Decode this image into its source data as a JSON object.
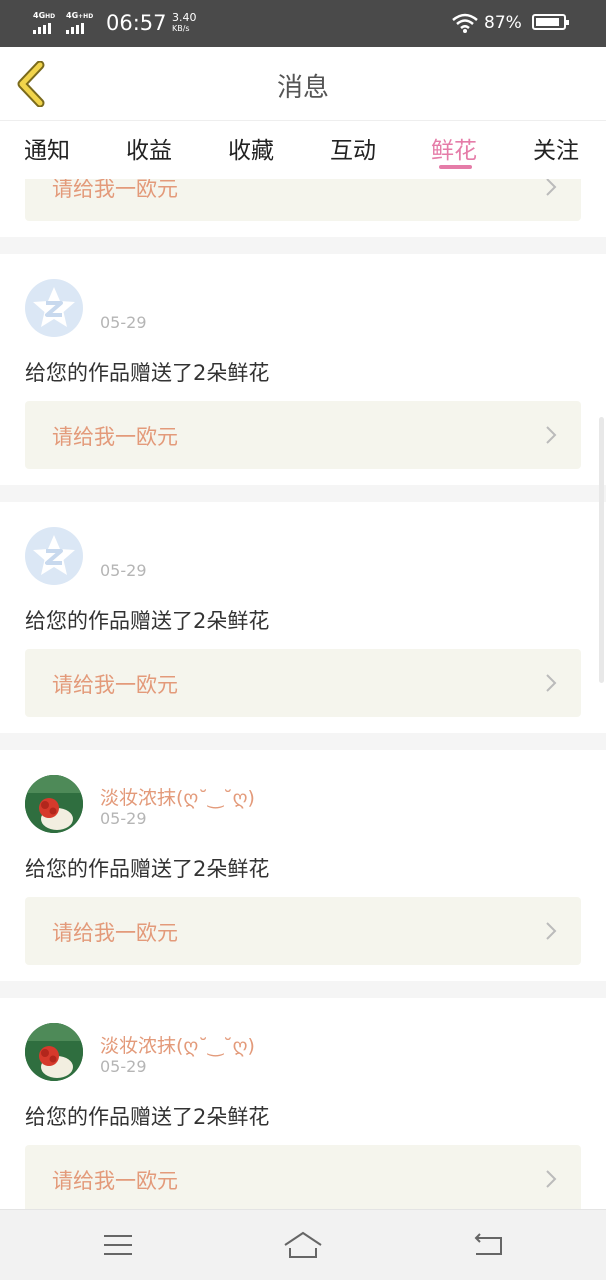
{
  "status_bar": {
    "network1": "4G",
    "network1_sup": "HD",
    "network2": "4G",
    "network2_sup": "+HD",
    "time": "06:57",
    "speed_value": "3.40",
    "speed_unit": "KB/s",
    "battery_percent": "87%",
    "battery_level": 0.87
  },
  "header": {
    "title": "消息",
    "back_icon": "chevron-left-icon"
  },
  "tabs": [
    {
      "label": "通知",
      "active": false
    },
    {
      "label": "收益",
      "active": false
    },
    {
      "label": "收藏",
      "active": false
    },
    {
      "label": "互动",
      "active": false
    },
    {
      "label": "鲜花",
      "active": true
    },
    {
      "label": "关注",
      "active": false
    }
  ],
  "colors": {
    "accent": "#e57ca8",
    "action_text": "#e39a7a",
    "action_bg": "#f5f5ed"
  },
  "messages": [
    {
      "username": "",
      "date": "",
      "text": "",
      "action_label": "请给我一欧元",
      "avatar": "partial"
    },
    {
      "username": "",
      "date": "05-29",
      "text": "给您的作品赠送了2朵鲜花",
      "action_label": "请给我一欧元",
      "avatar": "default-z-icon"
    },
    {
      "username": "",
      "date": "05-29",
      "text": "给您的作品赠送了2朵鲜花",
      "action_label": "请给我一欧元",
      "avatar": "default-z-icon"
    },
    {
      "username": "淡妆浓抹(ღ˘‿˘ღ)",
      "date": "05-29",
      "text": "给您的作品赠送了2朵鲜花",
      "action_label": "请给我一欧元",
      "avatar": "user-photo"
    },
    {
      "username": "淡妆浓抹(ღ˘‿˘ღ)",
      "date": "05-29",
      "text": "给您的作品赠送了2朵鲜花",
      "action_label": "请给我一欧元",
      "avatar": "user-photo"
    }
  ],
  "nav_bar": {
    "menu_icon": "menu-icon",
    "home_icon": "home-icon",
    "back_icon": "back-icon"
  }
}
